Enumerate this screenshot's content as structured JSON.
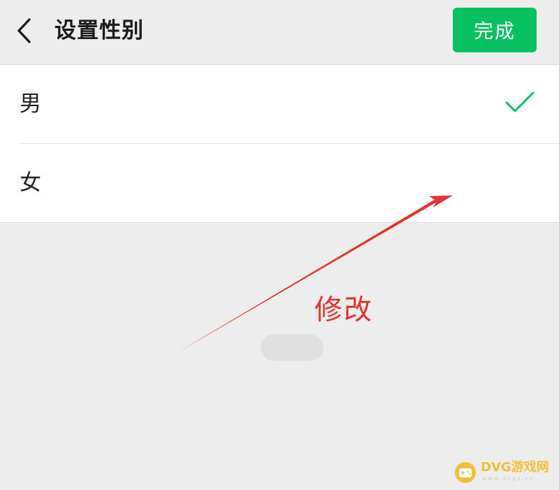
{
  "header": {
    "title": "设置性别",
    "done_label": "完成"
  },
  "options": [
    {
      "label": "男",
      "selected": true
    },
    {
      "label": "女",
      "selected": false
    }
  ],
  "annotation": {
    "text": "修改"
  },
  "watermark": {
    "name": "DVG游戏网",
    "domain": "www.dvgs.cn"
  },
  "colors": {
    "accent_green": "#07c160",
    "annotation_red": "#e8312b",
    "background": "#ededed",
    "row_background": "#ffffff",
    "watermark_yellow": "#f2b91c"
  },
  "icons": {
    "back": "chevron-left-icon",
    "selected": "check-icon"
  }
}
